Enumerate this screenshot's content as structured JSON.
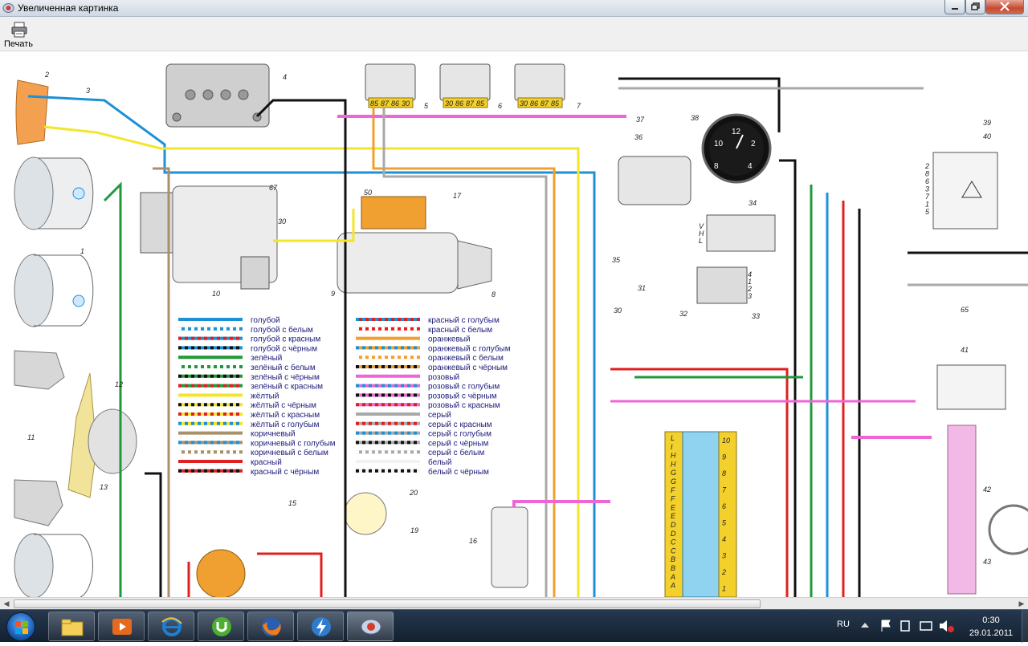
{
  "window": {
    "title": "Увеличенная картинка"
  },
  "toolbar": {
    "print_label": "Печать"
  },
  "legend": {
    "left": [
      {
        "label": "голубой",
        "base": "#1e90d6",
        "stripe": ""
      },
      {
        "label": "голубой с белым",
        "base": "#1e90d6",
        "stripe": "#ffffff"
      },
      {
        "label": "голубой с красным",
        "base": "#1e90d6",
        "stripe": "#e02020"
      },
      {
        "label": "голубой с чёрным",
        "base": "#1e90d6",
        "stripe": "#111111"
      },
      {
        "label": "зелёный",
        "base": "#1f9a3a",
        "stripe": ""
      },
      {
        "label": "зелёный с белым",
        "base": "#1f9a3a",
        "stripe": "#ffffff"
      },
      {
        "label": "зелёный с чёрным",
        "base": "#1f9a3a",
        "stripe": "#111111"
      },
      {
        "label": "зелёный с красным",
        "base": "#1f9a3a",
        "stripe": "#e02020"
      },
      {
        "label": "жёлтый",
        "base": "#f3e62a",
        "stripe": ""
      },
      {
        "label": "жёлтый с чёрным",
        "base": "#f3e62a",
        "stripe": "#111111"
      },
      {
        "label": "жёлтый с красным",
        "base": "#f3e62a",
        "stripe": "#e02020"
      },
      {
        "label": "жёлтый с голубым",
        "base": "#f3e62a",
        "stripe": "#1e90d6"
      },
      {
        "label": "коричневый",
        "base": "#a8916a",
        "stripe": ""
      },
      {
        "label": "коричневый с голубым",
        "base": "#a8916a",
        "stripe": "#1e90d6"
      },
      {
        "label": "коричневый с белым",
        "base": "#a8916a",
        "stripe": "#ffffff"
      },
      {
        "label": "красный",
        "base": "#e02020",
        "stripe": ""
      },
      {
        "label": "красный с чёрным",
        "base": "#e02020",
        "stripe": "#111111"
      }
    ],
    "right": [
      {
        "label": "красный с голубым",
        "base": "#e02020",
        "stripe": "#1e90d6"
      },
      {
        "label": "красный с белым",
        "base": "#e02020",
        "stripe": "#ffffff"
      },
      {
        "label": "оранжевый",
        "base": "#f0a030",
        "stripe": ""
      },
      {
        "label": "оранжевый с голубым",
        "base": "#f0a030",
        "stripe": "#1e90d6"
      },
      {
        "label": "оранжевый с белым",
        "base": "#f0a030",
        "stripe": "#ffffff"
      },
      {
        "label": "оранжевый с чёрным",
        "base": "#f0a030",
        "stripe": "#111111"
      },
      {
        "label": "розовый",
        "base": "#ee66d6",
        "stripe": ""
      },
      {
        "label": "розовый с голубым",
        "base": "#ee66d6",
        "stripe": "#1e90d6"
      },
      {
        "label": "розовый с чёрным",
        "base": "#ee66d6",
        "stripe": "#111111"
      },
      {
        "label": "розовый с красным",
        "base": "#ee66d6",
        "stripe": "#e02020"
      },
      {
        "label": "серый",
        "base": "#a9a9a9",
        "stripe": ""
      },
      {
        "label": "серый с красным",
        "base": "#a9a9a9",
        "stripe": "#e02020"
      },
      {
        "label": "серый с голубым",
        "base": "#a9a9a9",
        "stripe": "#1e90d6"
      },
      {
        "label": "серый с чёрным",
        "base": "#a9a9a9",
        "stripe": "#111111"
      },
      {
        "label": "серый с белым",
        "base": "#a9a9a9",
        "stripe": "#ffffff"
      },
      {
        "label": "белый",
        "base": "#f2f2f2",
        "stripe": ""
      },
      {
        "label": "белый с чёрным",
        "base": "#f2f2f2",
        "stripe": "#111111"
      }
    ]
  },
  "diagram": {
    "component_numbers": [
      "1",
      "2",
      "3",
      "4",
      "5",
      "6",
      "7",
      "8",
      "9",
      "10",
      "11",
      "12",
      "13",
      "15",
      "16",
      "17",
      "19",
      "20",
      "30",
      "31",
      "32",
      "33",
      "34",
      "35",
      "36",
      "37",
      "38",
      "39",
      "40",
      "41",
      "42",
      "43",
      "65"
    ],
    "terminal_labels": [
      "67",
      "30",
      "50"
    ],
    "relay_5_pins": [
      "85",
      "87",
      "86",
      "30"
    ],
    "relay_6_pins": [
      "30",
      "86",
      "87",
      "85"
    ],
    "relay_7_pins": [
      "30",
      "86",
      "87",
      "85"
    ],
    "gauge_numbers": [
      "12",
      "2",
      "4",
      "8",
      "10"
    ],
    "fuse_letters": [
      "L",
      "I",
      "H",
      "H",
      "G",
      "G",
      "F",
      "F",
      "E",
      "E",
      "D",
      "D",
      "C",
      "C",
      "B",
      "B",
      "A",
      "A"
    ],
    "fuse_numbers": [
      "10",
      "9",
      "8",
      "7",
      "6",
      "5",
      "4",
      "3",
      "2",
      "1"
    ],
    "connector_40_pins": [
      "2",
      "8",
      "6",
      "3",
      "7",
      "1",
      "5"
    ],
    "connector_33_pins": [
      "4",
      "1",
      "2",
      "3"
    ],
    "connector_34_pins": [
      "V",
      "H",
      "L"
    ]
  },
  "taskbar": {
    "apps": [
      {
        "name": "explorer"
      },
      {
        "name": "media-player"
      },
      {
        "name": "internet-explorer"
      },
      {
        "name": "utorrent"
      },
      {
        "name": "firefox"
      },
      {
        "name": "downloader"
      },
      {
        "name": "picture-viewer"
      }
    ],
    "language": "RU",
    "time": "0:30",
    "date": "29.01.2011"
  }
}
